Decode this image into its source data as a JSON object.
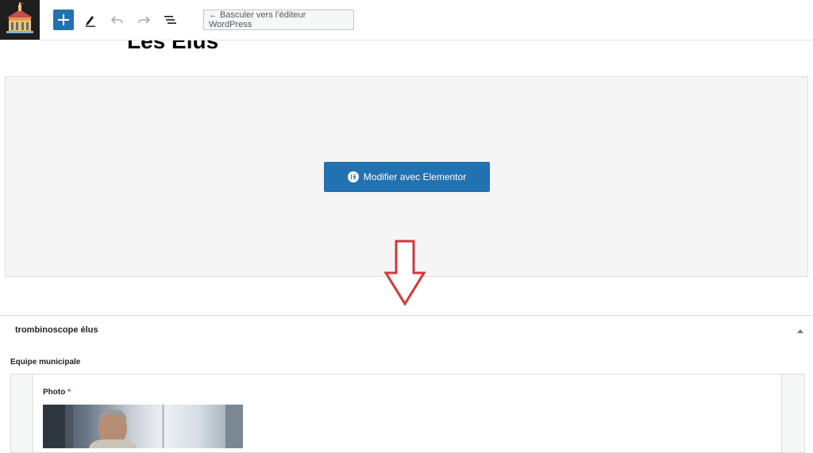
{
  "toolbar": {
    "logo_icon": "castle-icon",
    "inserter_icon": "plus-icon",
    "tools": [
      "pencil-icon",
      "undo-icon",
      "redo-icon",
      "list-view-icon"
    ],
    "switch_label": "← Basculer vers l’éditeur WordPress",
    "accent": "#2271b1"
  },
  "page": {
    "title": "Les Élus"
  },
  "elementor": {
    "button_label": "Modifier avec Elementor",
    "button_icon": "elementor-icon"
  },
  "annotation": {
    "arrow_icon": "down-arrow-icon",
    "arrow_color": "#d63638"
  },
  "metabox": {
    "title": "trombinoscope élus",
    "toggle_icon": "caret-up-icon",
    "field_label": "Equipe municipale",
    "subfield_label": "Photo",
    "required_mark": "*"
  }
}
